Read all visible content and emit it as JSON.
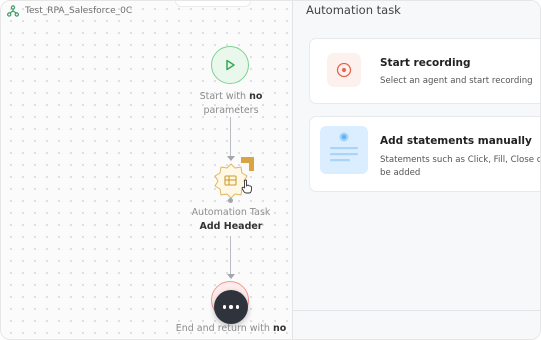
{
  "workflow": {
    "title": "Test_RPA_Salesforce_0C",
    "start_node": {
      "label_prefix": "Start with",
      "label_bold": "no",
      "label_suffix": "parameters"
    },
    "task_node": {
      "type_label": "Automation Task",
      "name": "Add Header"
    },
    "end_node": {
      "label_prefix": "End and return with",
      "label_bold": "no"
    },
    "fab": {
      "icon": "more-dots-icon"
    }
  },
  "panel": {
    "title": "Automation task",
    "options": [
      {
        "title": "Start recording",
        "description": "Select an agent and start recording",
        "icon": "record-icon"
      },
      {
        "title": "Add statements manually",
        "description": "Statements such as Click, Fill, Close can be added",
        "icon": "statement-doc-icon"
      }
    ]
  },
  "colors": {
    "start_green": "#7fd192",
    "end_red": "#f09a94",
    "task_gold": "#d9a443",
    "accent_blue": "#6bb7f2"
  }
}
